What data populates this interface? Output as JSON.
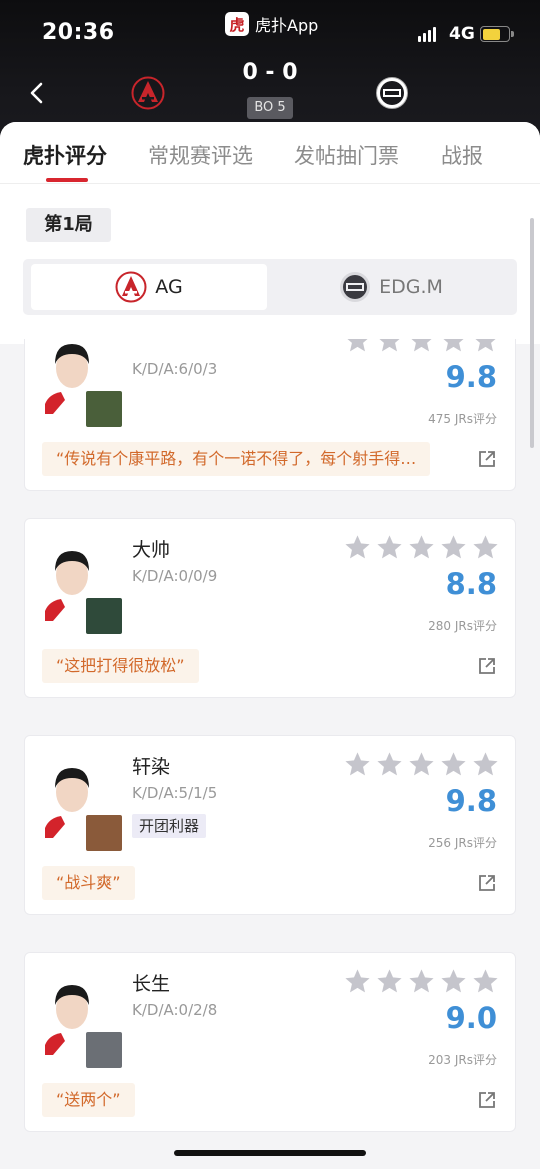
{
  "status_bar": {
    "time": "20:36",
    "network": "4G"
  },
  "app_badge": {
    "logo_char": "虎",
    "name": "虎扑App"
  },
  "match": {
    "score": "0 - 0",
    "format": "BO 5",
    "home_logo": "ag-team-logo",
    "away_logo": "edgm-team-logo"
  },
  "tabs": [
    {
      "label": "虎扑评分"
    },
    {
      "label": "常规赛评选"
    },
    {
      "label": "发帖抽门票"
    },
    {
      "label": "战报"
    }
  ],
  "round": {
    "label": "第1局"
  },
  "team_switch": {
    "home": "AG",
    "away": "EDG.M"
  },
  "colors": {
    "accent": "#d8262f",
    "score_blue": "#3f8fd6",
    "comment_text": "#d2692b"
  },
  "players": [
    {
      "name": "",
      "kda": "K/D/A:6/0/3",
      "score": "9.8",
      "votes": "475 JRs评分",
      "comment": "“传说有个康平路，有个一诺不得了，每个射手得…",
      "tag": "",
      "rating": 5,
      "hero_color": "#4a5f3a"
    },
    {
      "name": "大帅",
      "kda": "K/D/A:0/0/9",
      "score": "8.8",
      "votes": "280 JRs评分",
      "comment": "“这把打得很放松”",
      "tag": "",
      "rating": 5,
      "hero_color": "#2f4a3a"
    },
    {
      "name": "轩染",
      "kda": "K/D/A:5/1/5",
      "score": "9.8",
      "votes": "256 JRs评分",
      "comment": "“战斗爽”",
      "tag": "开团利器",
      "rating": 5,
      "hero_color": "#8a5a3a"
    },
    {
      "name": "长生",
      "kda": "K/D/A:0/2/8",
      "score": "9.0",
      "votes": "203 JRs评分",
      "comment": "“送两个”",
      "tag": "",
      "rating": 5,
      "hero_color": "#6b6f75"
    }
  ]
}
